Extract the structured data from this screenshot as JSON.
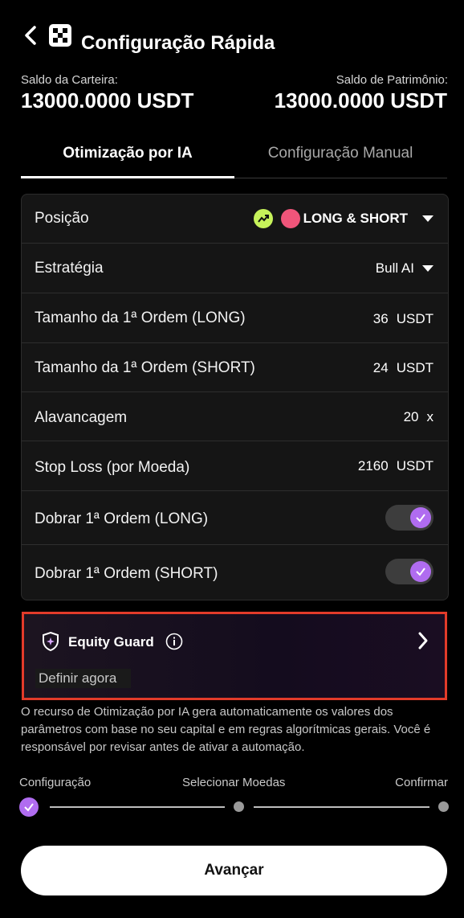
{
  "header": {
    "title": "Configuração Rápida",
    "back_icon": "chevron-left-icon",
    "app_icon": "dice-grid-icon"
  },
  "balances": {
    "wallet_label": "Saldo da Carteira:",
    "wallet_value": "13000.0000 USDT",
    "equity_label": "Saldo de Patrimônio:",
    "equity_value": "13000.0000 USDT"
  },
  "tabs": [
    {
      "label": "Otimização por IA",
      "active": true
    },
    {
      "label": "Configuração Manual",
      "active": false
    }
  ],
  "settings": {
    "position": {
      "label": "Posição",
      "value": "LONG & SHORT"
    },
    "strategy": {
      "label": "Estratégia",
      "value": "Bull AI"
    },
    "first_long": {
      "label": "Tamanho da 1ª Ordem (LONG)",
      "amount": "36",
      "unit": "USDT"
    },
    "first_short": {
      "label": "Tamanho da 1ª Ordem (SHORT)",
      "amount": "24",
      "unit": "USDT"
    },
    "leverage": {
      "label": "Alavancagem",
      "amount": "20",
      "unit": "x"
    },
    "stop_loss": {
      "label": "Stop Loss (por Moeda)",
      "amount": "2160",
      "unit": "USDT"
    },
    "double_long": {
      "label": "Dobrar 1ª Ordem (LONG)",
      "enabled": true
    },
    "double_short": {
      "label": "Dobrar 1ª Ordem (SHORT)",
      "enabled": true
    }
  },
  "equity_guard": {
    "title": "Equity Guard",
    "subtitle": "Definir agora",
    "border_color": "#e33b2a"
  },
  "note": "O recurso de Otimização por IA gera automaticamente os valores dos parâmetros com base no seu capital e em regras algorítmicas gerais. Você é responsável por revisar antes de ativar a automação.",
  "steps": [
    {
      "label": "Configuração",
      "done": true
    },
    {
      "label": "Selecionar Moedas",
      "done": false
    },
    {
      "label": "Confirmar",
      "done": false
    }
  ],
  "primary_button": "Avançar",
  "colors": {
    "accent": "#b06cf0",
    "long": "#c6f25a",
    "short": "#f0557a"
  }
}
